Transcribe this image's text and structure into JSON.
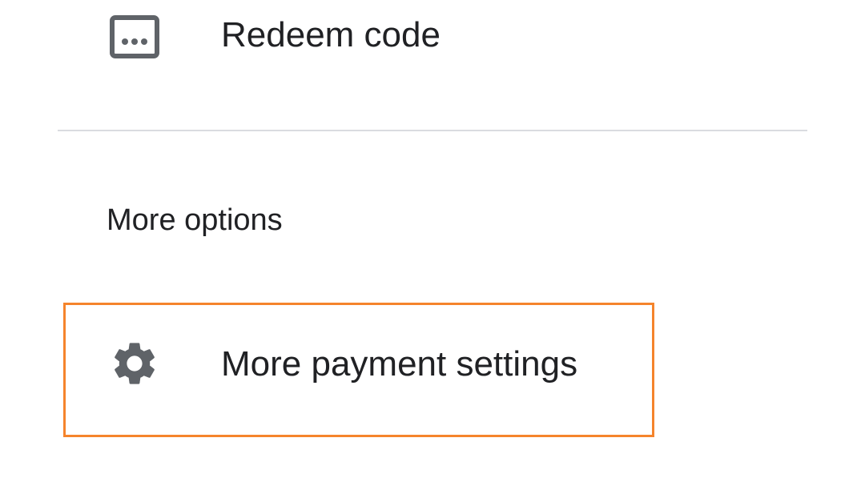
{
  "menu": {
    "redeem": {
      "label": "Redeem code",
      "icon": "redeem-code-icon"
    },
    "section_header": "More options",
    "payment_settings": {
      "label": "More payment settings",
      "icon": "gear-icon"
    }
  },
  "colors": {
    "text": "#202124",
    "icon": "#5f6368",
    "divider": "#dadce0",
    "highlight": "#f5842c"
  }
}
